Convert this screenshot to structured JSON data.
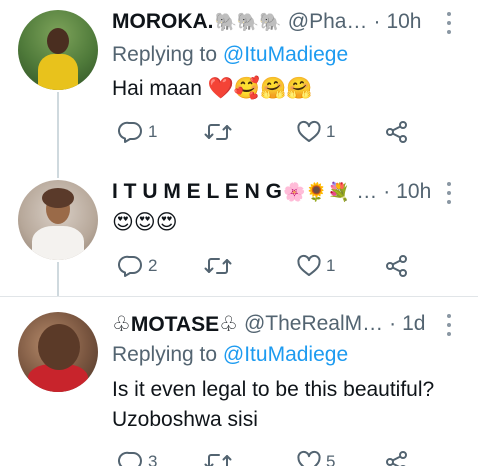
{
  "tweets": [
    {
      "display_name": "MOROKA.",
      "name_emoji": "🐘🐘🐘",
      "handle": "@Pha…",
      "separator": "·",
      "time": "10h",
      "replying_prefix": "Replying to",
      "replying_to": "@ItuMadiege",
      "text": "Hai maan",
      "text_emoji": "❤️🥰🤗🤗",
      "reply_count": "1",
      "retweet_count": "",
      "like_count": "1"
    },
    {
      "display_name": "I T U M E L E N G",
      "name_emoji": "🌸🌻💐",
      "handle": "…",
      "separator": "·",
      "time": "10h",
      "text": "😍😍😍",
      "reply_count": "2",
      "retweet_count": "",
      "like_count": "1"
    },
    {
      "display_name": "♧MOTASE♧",
      "handle": "@TheRealM…",
      "separator": "·",
      "time": "1d",
      "replying_prefix": "Replying to",
      "replying_to": "@ItuMadiege",
      "text_line1": "Is it even legal to be this beautiful?",
      "text_line2": "Uzoboshwa sisi",
      "reply_count": "3",
      "retweet_count": "",
      "like_count": "5"
    }
  ],
  "colors": {
    "mention": "#1d9bf0",
    "secondary_text": "#536471",
    "icon": "#536471"
  },
  "icons": [
    "reply-icon",
    "retweet-icon",
    "like-icon",
    "share-icon",
    "more-icon"
  ]
}
